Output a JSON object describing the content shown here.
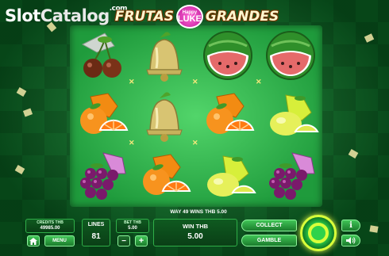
{
  "watermark": {
    "part1": "Slot",
    "part2": "Catalog",
    "suffix": ".com"
  },
  "logo": {
    "word_left": "FRUTAS",
    "badge_top": "Happy",
    "badge_main": "LUKE",
    "word_right": "GRANDES"
  },
  "reels": {
    "rows": [
      [
        "cherries",
        "bell",
        "watermelon",
        "watermelon"
      ],
      [
        "orange",
        "bell",
        "orange",
        "lemon"
      ],
      [
        "grapes",
        "orange",
        "lemon",
        "grapes"
      ]
    ]
  },
  "win_line_text": "WAY 49 WINS THB 5.00",
  "controls": {
    "credits_label": "CREDITS THB",
    "credits_value": "49985.00",
    "menu_label": "MENU",
    "lines_label": "LINES",
    "lines_value": "81",
    "bet_label": "BET THB",
    "bet_value": "5.00",
    "minus": "−",
    "plus": "+",
    "win_label": "WIN THB",
    "win_value": "5.00",
    "collect_label": "COLLECT",
    "gamble_label": "GAMBLE",
    "info_icon": "i",
    "sound_icon": "speaker-icon",
    "home_icon": "home-icon"
  }
}
